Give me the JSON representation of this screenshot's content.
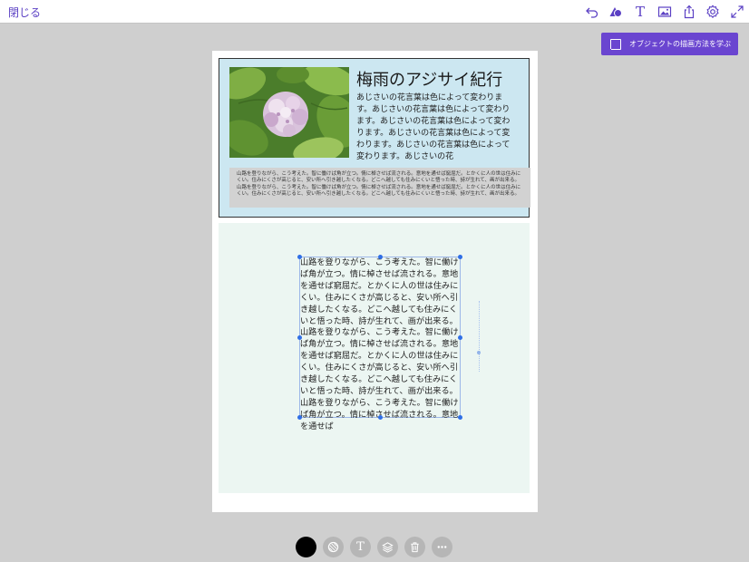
{
  "topbar": {
    "close_label": "閉じる",
    "tools": [
      "undo-icon",
      "shape-icon",
      "text-icon",
      "image-icon",
      "share-icon",
      "settings-icon",
      "fullscreen-icon"
    ],
    "text_tool_glyph": "T"
  },
  "learn_button": {
    "label": "オブジェクトの描画方法を学ぶ"
  },
  "card": {
    "title": "梅雨のアジサイ紀行",
    "description": "あじさいの花言葉は色によって変わります。あじさいの花言葉は色によって変わります。あじさいの花言葉は色によって変わります。あじさいの花言葉は色によって変わります。あじさいの花言葉は色によって変わります。あじさいの花",
    "gray_text": "山路を登りながら、こう考えた。智に働けば角が立つ。情に棹させば流される。意地を通せば窮屈だ。とかくに人の世は住みにくい。住みにくさが高じると、安い所へ引き越したくなる。どこへ越しても住みにくいと悟った時、詩が生れて、画が出来る。山路を登りながら、こう考えた。智に働けば角が立つ。情に棹させば流される。意地を通せば窮屈だ。とかくに人の世は住みにくい。住みにくさが高じると、安い所へ引き越したくなる。どこへ越しても住みにくいと悟った時、詩が生れて、画が出来る。"
  },
  "text_object": {
    "text": "山路を登りながら、こう考えた。智に働けば角が立つ。情に棹させば流される。意地を通せば窮屈だ。とかくに人の世は住みにくい。住みにくさが高じると、安い所へ引き越したくなる。どこへ越しても住みにくいと悟った時、詩が生れて、画が出来る。山路を登りながら、こう考えた。智に働けば角が立つ。情に棹させば流される。意地を通せば窮屈だ。とかくに人の世は住みにくい。住みにくさが高じると、安い所へ引き越したくなる。どこへ越しても住みにくいと悟った時、詩が生れて、画が出来る。山路を登りながら、こう考えた。智に働けば角が立つ。情に棹させば流される。意地を通せば"
  },
  "bottom_tools": {
    "items": [
      "color-swatch",
      "fill-icon",
      "text-icon",
      "layers-icon",
      "trash-icon",
      "more-icon"
    ],
    "text_glyph": "T",
    "selected_color": "#000000"
  },
  "colors": {
    "accent": "#6a45d0",
    "card_background": "#cce7f1",
    "section_background": "#ecf6f2",
    "selection": "#2f6ee6"
  }
}
